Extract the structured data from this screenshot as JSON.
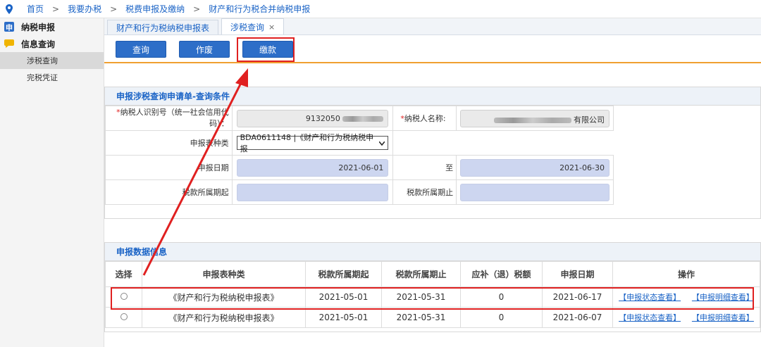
{
  "breadcrumb": {
    "items": [
      "首页",
      "我要办税",
      "税费申报及缴纳",
      "财产和行为税合并纳税申报"
    ],
    "separator": ">"
  },
  "sidebar": {
    "groups": [
      {
        "label": "纳税申报",
        "icon": "declaration-icon"
      },
      {
        "label": "信息查询",
        "icon": "info-chat-icon"
      }
    ],
    "items": [
      {
        "label": "涉税查询",
        "active": true
      },
      {
        "label": "完税凭证",
        "active": false
      }
    ]
  },
  "tabs": [
    {
      "label": "财产和行为税纳税申报表"
    },
    {
      "label": "涉税查询",
      "close": "×"
    }
  ],
  "toolbar": {
    "query_label": "查询",
    "void_label": "作废",
    "pay_label": "缴款"
  },
  "query": {
    "title": "申报涉税查询申请单-查询条件",
    "taxpayer_id_required": "*",
    "taxpayer_id_label": "纳税人识别号（统一社会信用代码）：",
    "taxpayer_id_value": "9132050",
    "taxpayer_name_required": "*",
    "taxpayer_name_label": "纳税人名称:",
    "taxpayer_name_value": "有限公司",
    "form_type_label": "申报表种类",
    "form_type_value": "BDA0611148 |《财产和行为税纳税申报",
    "declare_date_label": "申报日期",
    "declare_date_from": "2021-06-01",
    "to_label": "至",
    "declare_date_to": "2021-06-30",
    "period_start_label": "税款所属期起",
    "period_end_label": "税款所属期止"
  },
  "results": {
    "title": "申报数据信息",
    "columns": [
      "选择",
      "申报表种类",
      "税款所属期起",
      "税款所属期止",
      "应补（退）税额",
      "申报日期",
      "操作"
    ],
    "rows": [
      {
        "form": "《财产和行为税纳税申报表》",
        "start": "2021-05-01",
        "end": "2021-05-31",
        "amount": "0",
        "date": "2021-06-17",
        "op1": "【申报状态查看】",
        "op2": "【申报明细查看】"
      },
      {
        "form": "《财产和行为税纳税申报表》",
        "start": "2021-05-01",
        "end": "2021-05-31",
        "amount": "0",
        "date": "2021-06-07",
        "op1": "【申报状态查看】",
        "op2": "【申报明细查看】"
      }
    ]
  },
  "colors": {
    "accent": "#1a63c6",
    "button": "#2d6ec8",
    "highlight": "#e02020",
    "divider": "#f0a030"
  }
}
